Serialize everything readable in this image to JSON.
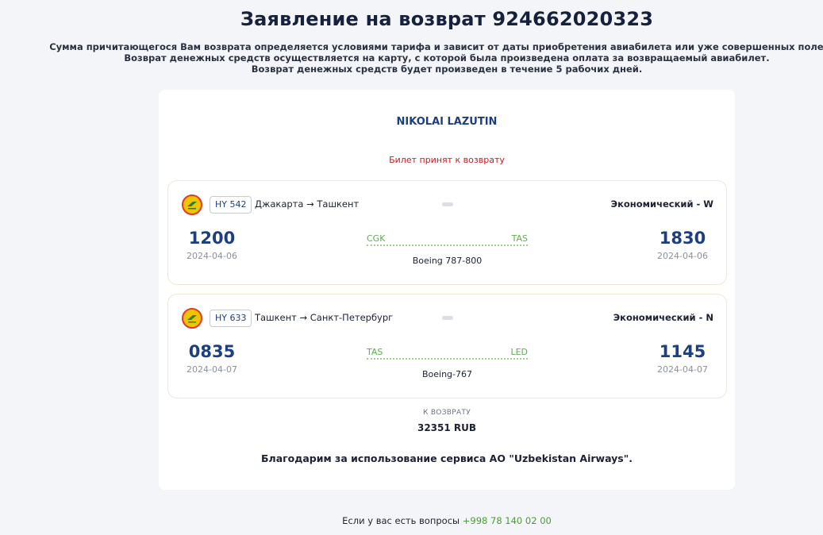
{
  "title": "Заявление на возврат 924662020323",
  "notice": [
    "Сумма причитающегося Вам возврата определяется условиями тарифа и зависит от даты приобретения авиабилета или уже совершенных полетов.",
    "Возврат денежных средств осуществляется на карту, с которой была произведена оплата за возвращаемый авиабилет.",
    "Возврат денежных средств будет произведен в течение 5 рабочих дней."
  ],
  "passenger": "NIKOLAI LAZUTIN",
  "status": "Билет принят к возврату",
  "flights": [
    {
      "flight_no": "HY 542",
      "route": "Джакарта → Ташкент",
      "cabin": "Экономический - W",
      "dep_time": "1200",
      "dep_date": "2024-04-06",
      "from_code": "CGK",
      "to_code": "TAS",
      "aircraft": "Boeing 787-800",
      "arr_time": "1830",
      "arr_date": "2024-04-06"
    },
    {
      "flight_no": "HY 633",
      "route": "Ташкент → Санкт-Петербург",
      "cabin": "Экономический - N",
      "dep_time": "0835",
      "dep_date": "2024-04-07",
      "from_code": "TAS",
      "to_code": "LED",
      "aircraft": "Boeing-767",
      "arr_time": "1145",
      "arr_date": "2024-04-07"
    }
  ],
  "refund": {
    "label": "К ВОЗВРАТУ",
    "amount": "32351 RUB"
  },
  "thanks": "Благодарим за использование сервиса АО \"Uzbekistan Airways\".",
  "footer": {
    "text": "Если у вас есть вопросы",
    "phone": "+998 78 140 02 00"
  },
  "icons": {
    "airline_logo": "airline-logo-icon"
  },
  "colors": {
    "accent_blue": "#1d3f80",
    "status_red": "#d01818",
    "route_green": "#5ab04b",
    "background": "#f4f5f8"
  }
}
